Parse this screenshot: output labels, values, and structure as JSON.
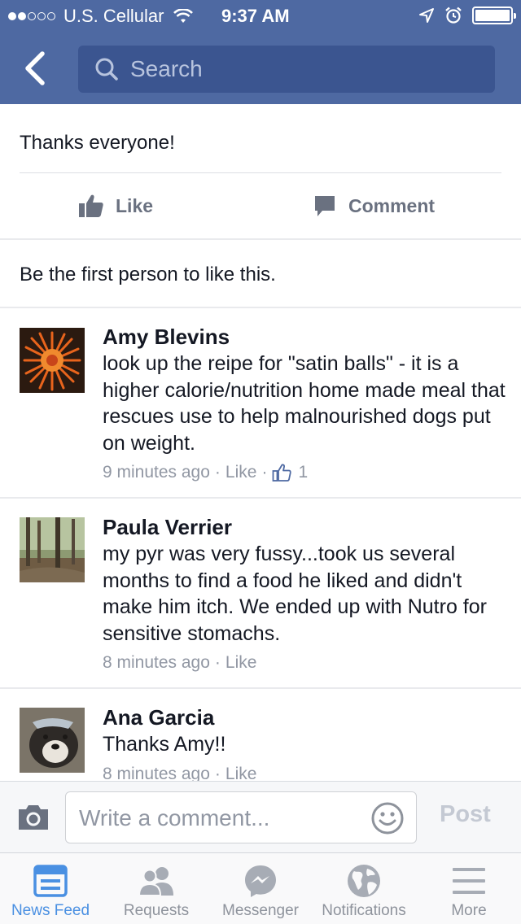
{
  "status_bar": {
    "carrier": "U.S. Cellular",
    "time": "9:37 AM"
  },
  "header": {
    "search_placeholder": "Search"
  },
  "post": {
    "text": "Thanks everyone!",
    "like_label": "Like",
    "comment_label": "Comment",
    "likes_summary": "Be the first person to like this."
  },
  "comments": [
    {
      "name": "Amy Blevins",
      "text": "look up the reipe for \"satin balls\" - it is a higher calorie/nutrition home made meal that rescues use to help malnourished dogs put on weight.",
      "time": "9 minutes ago",
      "like_label": "Like",
      "like_count": "1"
    },
    {
      "name": "Paula Verrier",
      "text": "my pyr was very fussy...took us several months to find a food he liked and didn't make him itch.  We ended up with Nutro for sensitive stomachs.",
      "time": "8 minutes ago",
      "like_label": "Like"
    },
    {
      "name": "Ana Garcia",
      "text": "Thanks Amy!!",
      "time": "8 minutes ago",
      "like_label": "Like"
    }
  ],
  "composer": {
    "placeholder": "Write a comment...",
    "post_label": "Post"
  },
  "tabbar": {
    "tabs": [
      {
        "label": "News Feed",
        "icon": "news-feed-icon",
        "active": true
      },
      {
        "label": "Requests",
        "icon": "requests-icon"
      },
      {
        "label": "Messenger",
        "icon": "messenger-icon"
      },
      {
        "label": "Notifications",
        "icon": "globe-icon"
      },
      {
        "label": "More",
        "icon": "menu-icon"
      }
    ]
  },
  "colors": {
    "brand_blue": "#4e69a2",
    "active_tab": "#4a90e2",
    "meta_gray": "#9197a3"
  }
}
